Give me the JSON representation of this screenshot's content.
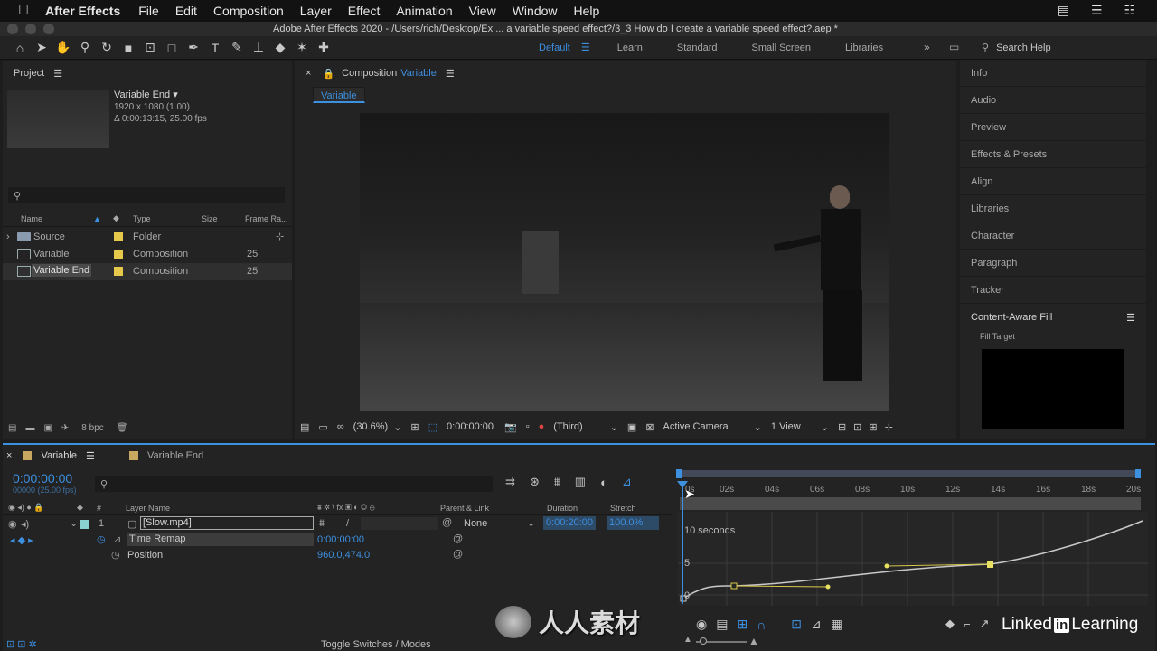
{
  "menubar": {
    "items": [
      "After Effects",
      "File",
      "Edit",
      "Composition",
      "Layer",
      "Effect",
      "Animation",
      "View",
      "Window",
      "Help"
    ]
  },
  "window": {
    "title": "Adobe After Effects 2020 - /Users/rich/Desktop/Ex ... a variable speed effect?/3_3 How do I create a variable speed effect?.aep *"
  },
  "workspaces": {
    "items": [
      "Default",
      "Learn",
      "Standard",
      "Small Screen",
      "Libraries"
    ],
    "active": "Default",
    "search_placeholder": "Search Help"
  },
  "project": {
    "title": "Project",
    "selected_name": "Variable End ▾",
    "selected_size": "1920 x 1080 (1.00)",
    "selected_duration": "Δ 0:00:13:15, 25.00 fps",
    "columns": [
      "Name",
      "Type",
      "Size",
      "Frame Ra..."
    ],
    "items": [
      {
        "name": "Source",
        "type": "Folder",
        "rate": "",
        "color": "#e6c84a"
      },
      {
        "name": "Variable",
        "type": "Composition",
        "rate": "25",
        "color": "#e6c84a"
      },
      {
        "name": "Variable End",
        "type": "Composition",
        "rate": "25",
        "color": "#e6c84a"
      }
    ],
    "bpc": "8 bpc"
  },
  "composition": {
    "label": "Composition",
    "name": "Variable",
    "tab": "Variable",
    "zoom": "(30.6%)",
    "timecode": "0:00:00:00",
    "resolution": "(Third)",
    "camera": "Active Camera",
    "views": "1 View"
  },
  "right_panels": {
    "items": [
      "Info",
      "Audio",
      "Preview",
      "Effects & Presets",
      "Align",
      "Libraries",
      "Character",
      "Paragraph",
      "Tracker"
    ],
    "content_aware": "Content-Aware Fill",
    "fill_target": "Fill Target"
  },
  "timeline": {
    "tabs": [
      "Variable",
      "Variable End"
    ],
    "timecode": "0:00:00:00",
    "frames": "00000 (25.00 fps)",
    "columns": {
      "layer_name": "Layer Name",
      "parent": "Parent & Link",
      "duration": "Duration",
      "stretch": "Stretch"
    },
    "layer": {
      "num": "1",
      "name": "[Slow.mp4]",
      "parent": "None",
      "duration": "0:00:20:00",
      "stretch": "100.0%"
    },
    "props": [
      {
        "name": "Time Remap",
        "value": "0:00:00:00"
      },
      {
        "name": "Position",
        "value": "960.0,474.0"
      }
    ],
    "ruler": [
      "0s",
      "02s",
      "04s",
      "06s",
      "08s",
      "10s",
      "12s",
      "14s",
      "16s",
      "18s",
      "20s"
    ],
    "graph_labels": {
      "top": "10 seconds",
      "mid": "5",
      "bottom": "0"
    },
    "toggle": "Toggle Switches / Modes"
  },
  "watermark": {
    "brand": "人人素材",
    "linkedin_pre": "Linked",
    "linkedin_in": "in",
    "linkedin_post": "Learning"
  }
}
